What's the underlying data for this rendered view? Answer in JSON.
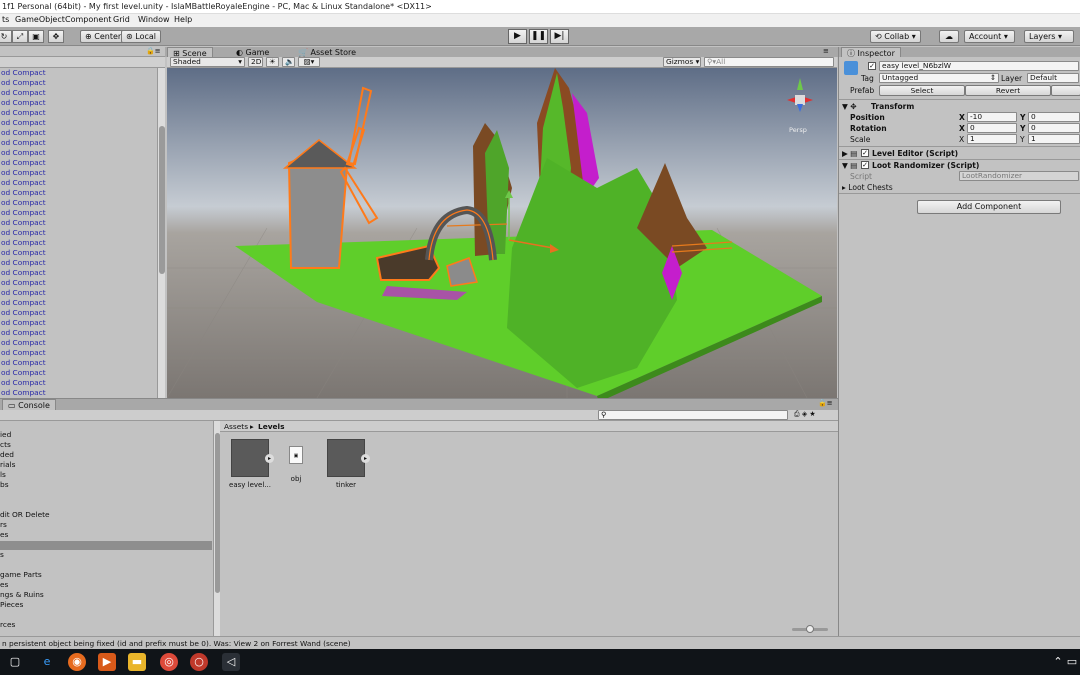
{
  "window": {
    "title": "1f1 Personal (64bit) - My first level.unity - IslaMBattleRoyaleEngine - PC, Mac & Linux Standalone* <DX11>"
  },
  "menu": [
    "ts",
    "GameObject",
    "Component",
    "Grid",
    "Window",
    "Help"
  ],
  "toolbar": {
    "pivot_label": "Center",
    "space_label": "Local",
    "play_icon": "play-icon",
    "pause_icon": "pause-icon",
    "step_icon": "step-icon",
    "collab_label": "Collab",
    "account_label": "Account",
    "layers_label": "Layers"
  },
  "hierarchy": {
    "items": [
      "od Compact",
      "od Compact",
      "od Compact",
      "od Compact",
      "od Compact",
      "od Compact",
      "od Compact",
      "od Compact",
      "od Compact",
      "od Compact",
      "od Compact",
      "od Compact",
      "od Compact",
      "od Compact",
      "od Compact",
      "od Compact",
      "od Compact",
      "od Compact",
      "od Compact",
      "od Compact",
      "od Compact",
      "od Compact",
      "od Compact",
      "od Compact",
      "od Compact",
      "od Compact",
      "od Compact",
      "od Compact",
      "od Compact",
      "od Compact",
      "od Compact",
      "od Compact",
      "od Compact"
    ]
  },
  "scene": {
    "tabs": {
      "scene": "Scene",
      "game": "Game",
      "asset_store": "Asset Store"
    },
    "shading_mode": "Shaded",
    "mode_2d": "2D",
    "gizmos_label": "Gizmos",
    "search_placeholder": "All",
    "persp_label": "Persp"
  },
  "console": {
    "tab_label": "Console"
  },
  "project": {
    "breadcrumb": {
      "root": "Assets",
      "sep": "▸",
      "current": "Levels"
    },
    "folders": [
      "ied",
      "cts",
      "ded",
      "rials",
      "ls",
      "bs",
      "",
      "",
      "dit OR Delete",
      "rs",
      "es",
      "",
      "s",
      "",
      "game Parts",
      "es",
      "ngs & Ruins",
      "Pieces",
      "",
      "rces"
    ],
    "assets": [
      {
        "label": "easy level..."
      },
      {
        "label": "obj"
      },
      {
        "label": "tinker"
      }
    ]
  },
  "inspector": {
    "tab_label": "Inspector",
    "object_name": "easy level_N6bzlW",
    "tag_label": "Tag",
    "tag_value": "Untagged",
    "layer_label": "Layer",
    "layer_value": "Default",
    "prefab_label": "Prefab",
    "prefab_select": "Select",
    "prefab_revert": "Revert",
    "transform": {
      "title": "Transform",
      "position_label": "Position",
      "rotation_label": "Rotation",
      "scale_label": "Scale",
      "x_label": "X",
      "y_label": "Y",
      "position": {
        "x": "-10",
        "y": "0"
      },
      "rotation": {
        "x": "0",
        "y": "0"
      },
      "scale": {
        "x": "1",
        "y": "1"
      }
    },
    "components": [
      {
        "title": "Level Editor (Script)"
      },
      {
        "title": "Loot Randomizer (Script)"
      }
    ],
    "script_label": "Script",
    "script_value": "LootRandomizer",
    "loot_chests_label": "Loot Chests",
    "add_component_label": "Add Component"
  },
  "status": {
    "message": "n persistent object being fixed (id and prefix must be 0). Was: View 2 on Forrest Wand (scene)"
  },
  "colors": {
    "terrain_green": "#5fce2a",
    "terrain_orange_rim": "#e6781e",
    "selection_orange": "#ff7a1a",
    "mountain_magenta": "#d01ed8",
    "mountain_brown": "#7a4a23"
  }
}
